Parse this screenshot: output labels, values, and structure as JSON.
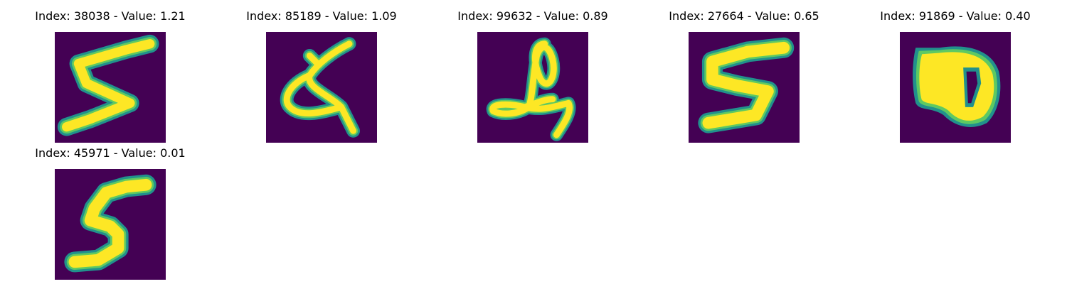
{
  "colors": {
    "background": "#440154",
    "stroke_edge": "#21918c",
    "stroke_mid": "#5ec962",
    "stroke_core": "#fde725"
  },
  "panels": [
    {
      "title": "Index: 38038 - Value: 1.21",
      "image_name": "digit-5-image"
    },
    {
      "title": "Index: 85189 - Value: 1.09",
      "image_name": "digit-loop-image"
    },
    {
      "title": "Index: 99632 - Value: 0.89",
      "image_name": "digit-scribble-image"
    },
    {
      "title": "Index: 27664 - Value: 0.65",
      "image_name": "digit-5-image"
    },
    {
      "title": "Index: 91869 - Value: 0.40",
      "image_name": "digit-blob-image"
    },
    {
      "title": "Index: 45971 - Value: 0.01",
      "image_name": "digit-5-image"
    }
  ]
}
